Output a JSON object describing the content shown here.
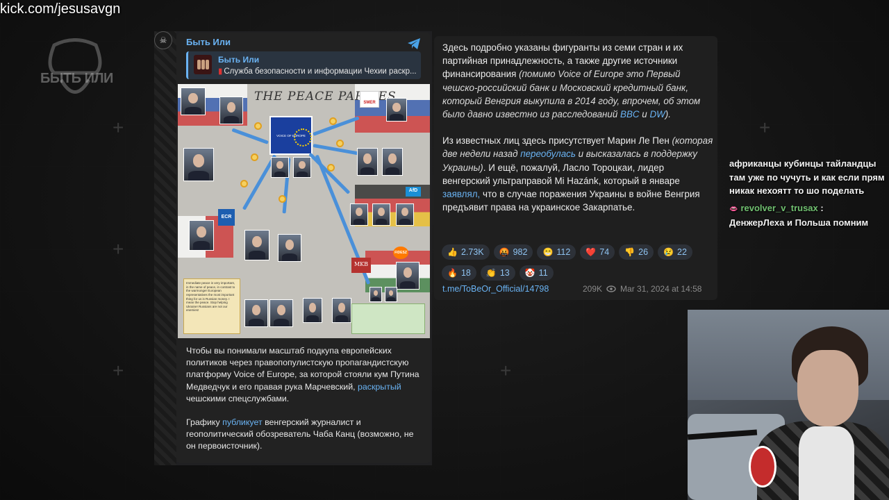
{
  "stream": {
    "url": "kick.com/jesusavgn",
    "logo_text": "БЫТЬ ИЛИ"
  },
  "post": {
    "channel_name": "Быть Или",
    "reply": {
      "title": "Быть Или",
      "text": "Служба безопасности и информации Чехии раскр..."
    },
    "infographic": {
      "title": "THE PEACE PARTIES",
      "center_label": "VOICE OF EUROPE",
      "badges": {
        "smer": "SMER",
        "afd": "AfD",
        "ecr": "ECR",
        "mkb": "MKB",
        "fidesz": "FIDESZ"
      },
      "quote": "Immediate peace is very important, in the name of peace, in contrast to the warmonger European representatives the most important thing for us is Russian money. I mean the peace. Stop helping Ukraine! Russians are not our enemies!"
    },
    "text_p1_a": "Чтобы вы понимали масштаб подкупа европейских политиков через правопопулистскую пропагандистскую платформу Voice of Europe, за которой стояли кум Путина Медведчук и его правая рука Марчевский, ",
    "text_p1_link": "раскрытый",
    "text_p1_b": " чешскими спецслужбами.",
    "text_p2_a": "Графику ",
    "text_p2_link": "публикует",
    "text_p2_b": " венгерский журналист и геополитический обозреватель Чаба Канц (возможно, не он первоисточник).",
    "right_p1_a": "Здесь подробно указаны фигуранты из семи стран и их партийная принадлежность, а также другие источники финансирования ",
    "right_p1_i": "(помимо Voice of Europe это Первый чешско-российский банк и Московский кредитный банк, который Венгрия выкупила в 2014 году, впрочем, об этом было давно известно из расследований ",
    "right_p1_link1": "BBC",
    "right_p1_and": " и ",
    "right_p1_link2": "DW",
    "right_p1_end": ").",
    "right_p2_a": "Из известных лиц здесь присутствует Марин Ле Пен ",
    "right_p2_i1": "(которая две недели назад ",
    "right_p2_link1": "переобулась",
    "right_p2_i2": " и высказалась в поддержку Украины)",
    "right_p2_b": ". И ещё, пожалуй, Ласло Тороцкаи, лидер венгерский ультраправой Mi Hazánk, который в январе ",
    "right_p2_link2": "заявлял,",
    "right_p2_c": " что в случае поражения Украины в войне Венгрия предъявит права на украинское Закарпатье.",
    "reactions": [
      {
        "emoji": "👍",
        "count": "2.73K"
      },
      {
        "emoji": "🤬",
        "count": "982"
      },
      {
        "emoji": "😁",
        "count": "112"
      },
      {
        "emoji": "❤️",
        "count": "74"
      },
      {
        "emoji": "👎",
        "count": "26"
      },
      {
        "emoji": "😢",
        "count": "22"
      },
      {
        "emoji": "🔥",
        "count": "18"
      },
      {
        "emoji": "👏",
        "count": "13"
      },
      {
        "emoji": "🤡",
        "count": "11"
      }
    ],
    "link": "t.me/ToBeOr_Official/14798",
    "views": "209K",
    "date": "Mar 31, 2024 at 14:58"
  },
  "chat": {
    "msg1": "африканцы кубинцы тайландцы там уже по чучуть и как если прям никак нехоятт то шо поделать",
    "msg2_user": "revolver_v_trusax",
    "msg2_sep": " :",
    "msg2_text": "ДенжерЛеха и Польша помним"
  },
  "colors": {
    "link": "#6ab3f3",
    "accent": "#4a90d9",
    "bg": "#141414"
  }
}
